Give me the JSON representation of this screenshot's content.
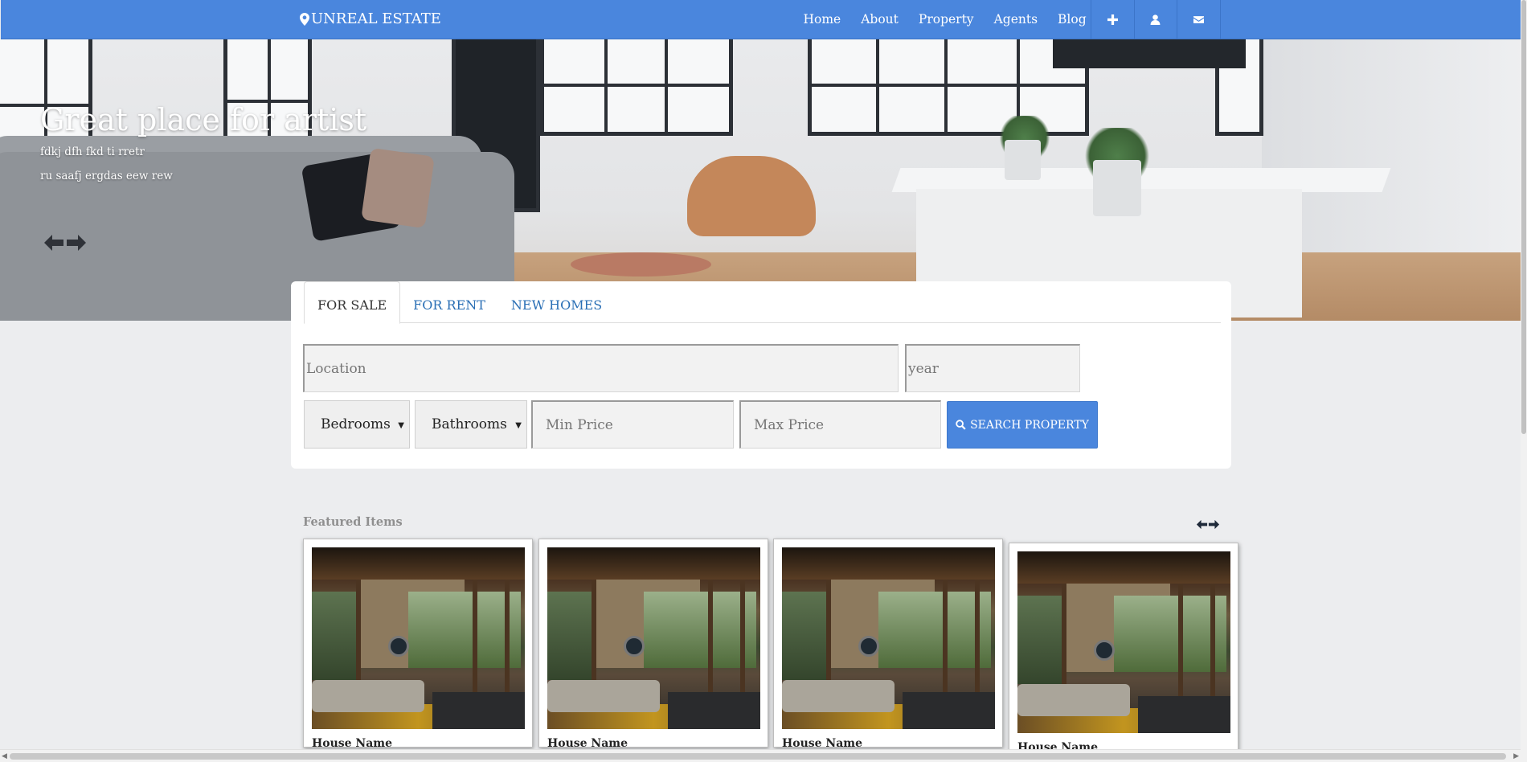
{
  "brand": {
    "name": "UNREAL ESTATE",
    "icon": "map-marker-icon"
  },
  "nav": {
    "links": [
      "Home",
      "About",
      "Property",
      "Agents",
      "Blog"
    ],
    "icons": [
      "plus-icon",
      "user-icon",
      "envelope-icon"
    ]
  },
  "hero": {
    "title": "Great place for artist",
    "line1": "fdkj dfh fkd ti rretr",
    "line2": "ru saafj ergdas eew rew"
  },
  "search": {
    "tabs": [
      "FOR SALE",
      "FOR RENT",
      "NEW HOMES"
    ],
    "active_tab": "FOR SALE",
    "location_placeholder": "Location",
    "year_placeholder": "year",
    "bedrooms": "Bedrooms",
    "bathrooms": "Bathrooms",
    "min_price_placeholder": "Min Price",
    "max_price_placeholder": "Max Price",
    "button": "SEARCH PROPERTY"
  },
  "featured": {
    "title": "Featured Items",
    "cards": [
      {
        "name": "House Name"
      },
      {
        "name": "House Name"
      },
      {
        "name": "House Name"
      },
      {
        "name": "House Name"
      }
    ]
  },
  "colors": {
    "primary": "#4a86dd",
    "link": "#2a6fb5",
    "background": "#ecedef"
  }
}
